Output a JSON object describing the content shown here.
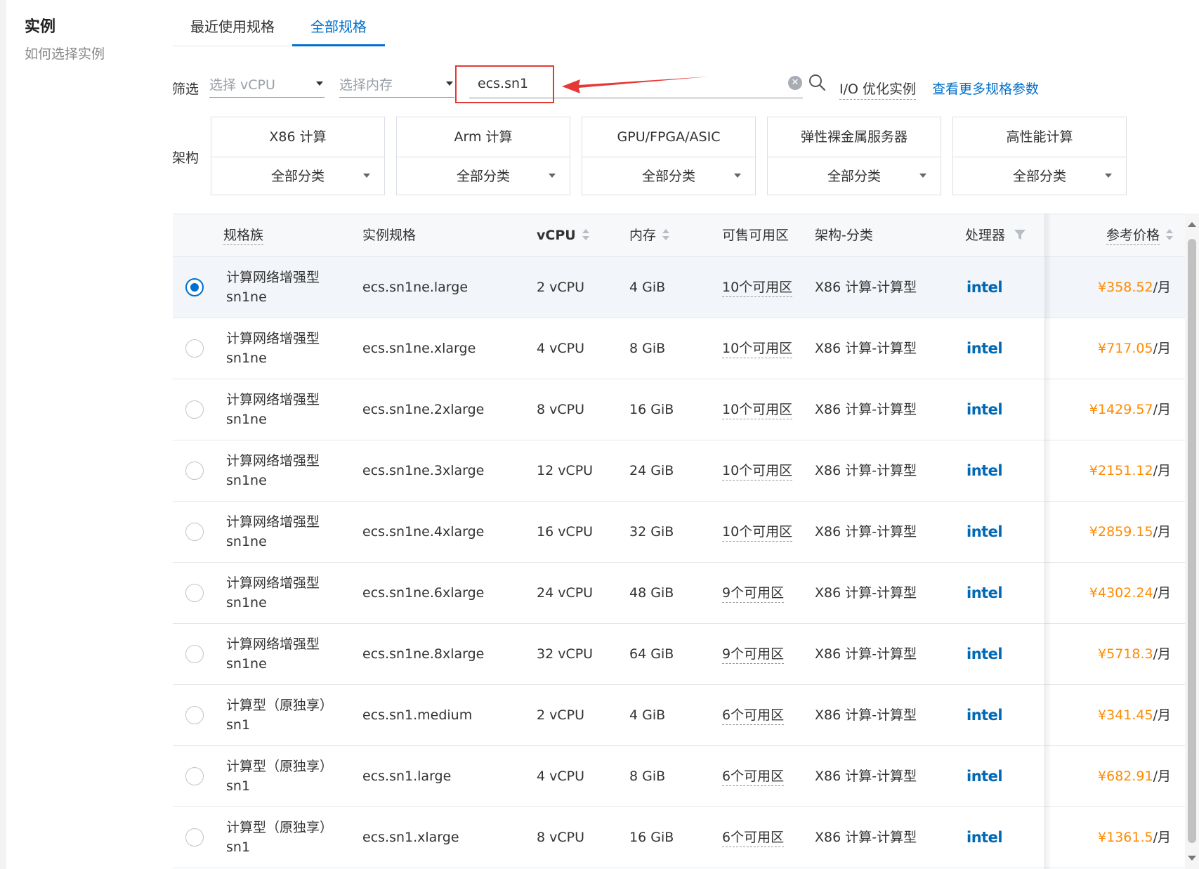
{
  "sidebar": {
    "title": "实例",
    "help_link": "如何选择实例"
  },
  "tabs": [
    {
      "label": "最近使用规格",
      "active": false
    },
    {
      "label": "全部规格",
      "active": true
    }
  ],
  "filter": {
    "label": "筛选",
    "vcpu_placeholder": "选择 vCPU",
    "memory_placeholder": "选择内存",
    "search_value": "ecs.sn1",
    "io_optimized": "I/O 优化实例",
    "more_params_link": "查看更多规格参数"
  },
  "architecture": {
    "label": "架构",
    "options": [
      {
        "name": "X86 计算",
        "category": "全部分类"
      },
      {
        "name": "Arm 计算",
        "category": "全部分类"
      },
      {
        "name": "GPU/FPGA/ASIC",
        "category": "全部分类"
      },
      {
        "name": "弹性裸金属服务器",
        "category": "全部分类"
      },
      {
        "name": "高性能计算",
        "category": "全部分类"
      }
    ]
  },
  "table": {
    "headers": {
      "family": "规格族",
      "spec": "实例规格",
      "vcpu": "vCPU",
      "memory": "内存",
      "zones": "可售可用区",
      "arch": "架构-分类",
      "processor": "处理器",
      "price": "参考价格"
    },
    "rows": [
      {
        "family": "计算网络增强型",
        "code": "sn1ne",
        "spec": "ecs.sn1ne.large",
        "vcpu": "2 vCPU",
        "memory": "4 GiB",
        "zones": "10个可用区",
        "arch": "X86 计算-计算型",
        "processor": "intel",
        "price": "¥358.52",
        "unit": "/月",
        "selected": true
      },
      {
        "family": "计算网络增强型",
        "code": "sn1ne",
        "spec": "ecs.sn1ne.xlarge",
        "vcpu": "4 vCPU",
        "memory": "8 GiB",
        "zones": "10个可用区",
        "arch": "X86 计算-计算型",
        "processor": "intel",
        "price": "¥717.05",
        "unit": "/月",
        "selected": false
      },
      {
        "family": "计算网络增强型",
        "code": "sn1ne",
        "spec": "ecs.sn1ne.2xlarge",
        "vcpu": "8 vCPU",
        "memory": "16 GiB",
        "zones": "10个可用区",
        "arch": "X86 计算-计算型",
        "processor": "intel",
        "price": "¥1429.57",
        "unit": "/月",
        "selected": false
      },
      {
        "family": "计算网络增强型",
        "code": "sn1ne",
        "spec": "ecs.sn1ne.3xlarge",
        "vcpu": "12 vCPU",
        "memory": "24 GiB",
        "zones": "10个可用区",
        "arch": "X86 计算-计算型",
        "processor": "intel",
        "price": "¥2151.12",
        "unit": "/月",
        "selected": false
      },
      {
        "family": "计算网络增强型",
        "code": "sn1ne",
        "spec": "ecs.sn1ne.4xlarge",
        "vcpu": "16 vCPU",
        "memory": "32 GiB",
        "zones": "10个可用区",
        "arch": "X86 计算-计算型",
        "processor": "intel",
        "price": "¥2859.15",
        "unit": "/月",
        "selected": false
      },
      {
        "family": "计算网络增强型",
        "code": "sn1ne",
        "spec": "ecs.sn1ne.6xlarge",
        "vcpu": "24 vCPU",
        "memory": "48 GiB",
        "zones": "9个可用区",
        "arch": "X86 计算-计算型",
        "processor": "intel",
        "price": "¥4302.24",
        "unit": "/月",
        "selected": false
      },
      {
        "family": "计算网络增强型",
        "code": "sn1ne",
        "spec": "ecs.sn1ne.8xlarge",
        "vcpu": "32 vCPU",
        "memory": "64 GiB",
        "zones": "9个可用区",
        "arch": "X86 计算-计算型",
        "processor": "intel",
        "price": "¥5718.3",
        "unit": "/月",
        "selected": false
      },
      {
        "family": "计算型（原独享）",
        "code": "sn1",
        "spec": "ecs.sn1.medium",
        "vcpu": "2 vCPU",
        "memory": "4 GiB",
        "zones": "6个可用区",
        "arch": "X86 计算-计算型",
        "processor": "intel",
        "price": "¥341.45",
        "unit": "/月",
        "selected": false
      },
      {
        "family": "计算型（原独享）",
        "code": "sn1",
        "spec": "ecs.sn1.large",
        "vcpu": "4 vCPU",
        "memory": "8 GiB",
        "zones": "6个可用区",
        "arch": "X86 计算-计算型",
        "processor": "intel",
        "price": "¥682.91",
        "unit": "/月",
        "selected": false
      },
      {
        "family": "计算型（原独享）",
        "code": "sn1",
        "spec": "ecs.sn1.xlarge",
        "vcpu": "8 vCPU",
        "memory": "16 GiB",
        "zones": "6个可用区",
        "arch": "X86 计算-计算型",
        "processor": "intel",
        "price": "¥1361.5",
        "unit": "/月",
        "selected": false
      }
    ]
  },
  "colors": {
    "accent": "#0070cc",
    "price": "#ff8a00",
    "annotation": "#e53935",
    "intel": "#0068b5"
  }
}
